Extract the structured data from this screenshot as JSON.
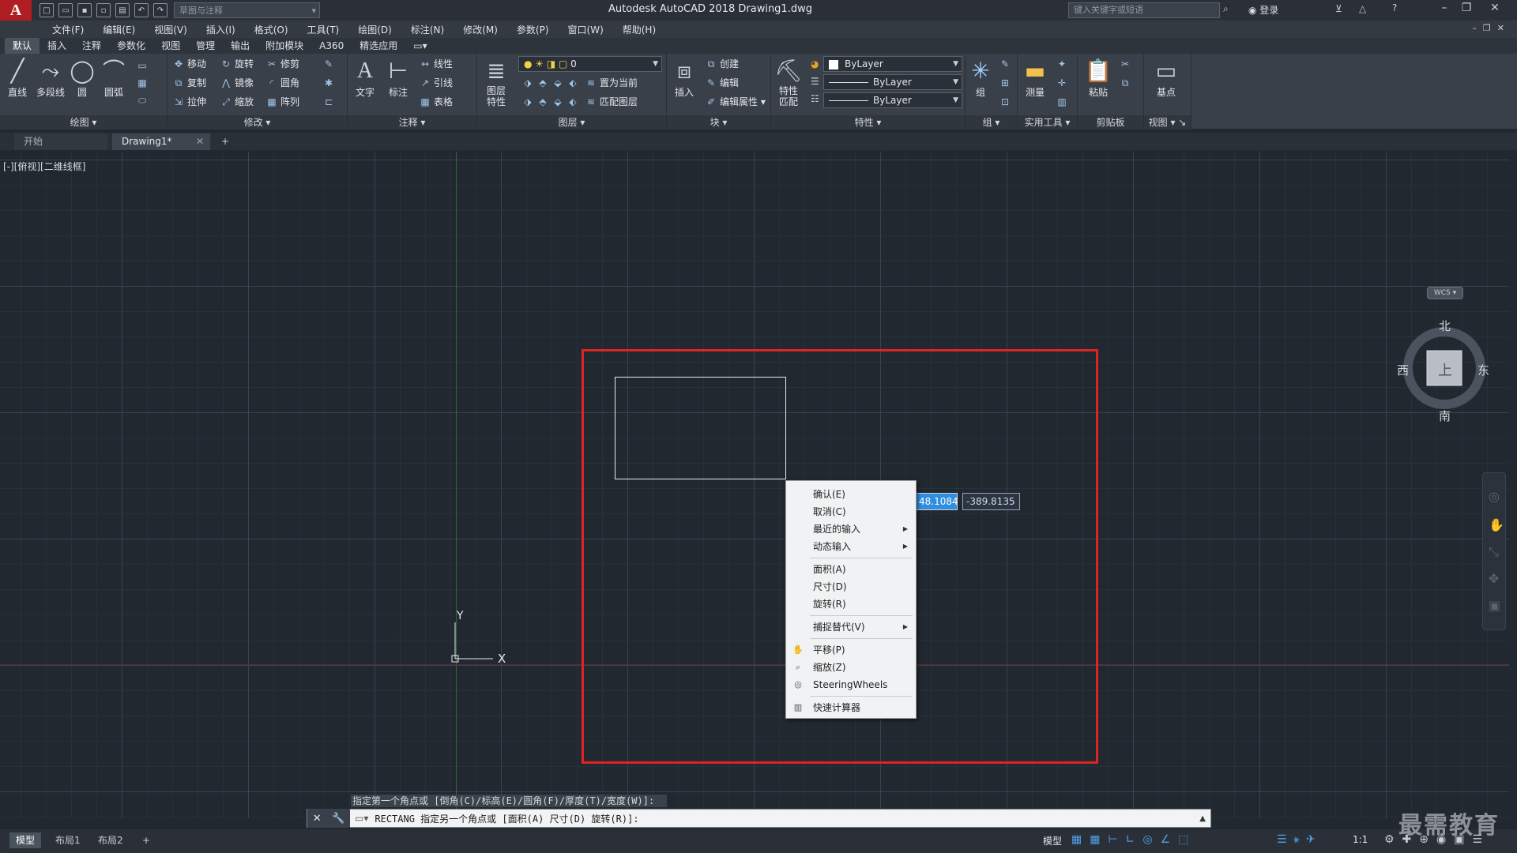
{
  "titlebar": {
    "logo": "A",
    "workspace": "草图与注释",
    "app_title": "Autodesk AutoCAD 2018    Drawing1.dwg",
    "search_placeholder": "键入关键字或短语",
    "login": "登录"
  },
  "menubar": {
    "items": [
      "文件(F)",
      "编辑(E)",
      "视图(V)",
      "插入(I)",
      "格式(O)",
      "工具(T)",
      "绘图(D)",
      "标注(N)",
      "修改(M)",
      "参数(P)",
      "窗口(W)",
      "帮助(H)"
    ]
  },
  "ribbon_tabs": {
    "items": [
      "默认",
      "插入",
      "注释",
      "参数化",
      "视图",
      "管理",
      "输出",
      "附加模块",
      "A360",
      "精选应用"
    ],
    "active_index": 0
  },
  "ribbon": {
    "draw": {
      "title": "绘图",
      "line": "直线",
      "polyline": "多段线",
      "circle": "圆",
      "arc": "圆弧"
    },
    "modify": {
      "title": "修改",
      "move": "移动",
      "rotate": "旋转",
      "trim": "修剪",
      "copy": "复制",
      "mirror": "镜像",
      "fillet": "圆角",
      "stretch": "拉伸",
      "scale": "缩放",
      "array": "阵列"
    },
    "annotation": {
      "title": "注释",
      "text": "文字",
      "dimension": "标注",
      "linear": "线性",
      "leader": "引线",
      "table": "表格"
    },
    "layers": {
      "title": "图层",
      "layer_props": "图层\n特性",
      "layer_value": "0",
      "set_current": "置为当前",
      "match_layer": "匹配图层"
    },
    "block": {
      "title": "块",
      "insert": "插入",
      "create": "创建",
      "edit": "编辑",
      "edit_attr": "编辑属性"
    },
    "properties": {
      "title": "特性",
      "match": "特性\n匹配",
      "color": "ByLayer",
      "linetype": "ByLayer",
      "lineweight": "ByLayer"
    },
    "groups": {
      "title": "组",
      "group": "组"
    },
    "utilities": {
      "title": "实用工具",
      "measure": "测量"
    },
    "clipboard": {
      "title": "剪贴板",
      "paste": "粘贴"
    },
    "view": {
      "title": "视图",
      "base": "基点"
    }
  },
  "doc_tabs": {
    "start": "开始",
    "drawing": "Drawing1*"
  },
  "canvas": {
    "view_label": "[-][俯视][二维线框]"
  },
  "ucs": {
    "y": "Y",
    "x": "X"
  },
  "dyn_input": {
    "x_value": "48.1084",
    "y_value": "-389.8135"
  },
  "context_menu": {
    "confirm": "确认(E)",
    "cancel": "取消(C)",
    "recent_input": "最近的输入",
    "dynamic_input": "动态输入",
    "area": "面积(A)",
    "dimensions": "尺寸(D)",
    "rotation": "旋转(R)",
    "snap_override": "捕捉替代(V)",
    "pan": "平移(P)",
    "zoom": "缩放(Z)",
    "steering": "SteeringWheels",
    "quickcalc": "快速计算器"
  },
  "viewcube": {
    "north": "北",
    "south": "南",
    "east": "东",
    "west": "西",
    "top": "上",
    "wcs": "WCS"
  },
  "command": {
    "history": "指定第一个角点或 [倒角(C)/标高(E)/圆角(F)/厚度(T)/宽度(W)]:",
    "prompt": "RECTANG 指定另一个角点或 [面积(A) 尺寸(D) 旋转(R)]:"
  },
  "statusbar": {
    "model_tab": "模型",
    "layout1": "布局1",
    "layout2": "布局2",
    "model": "模型",
    "scale": "1:1"
  },
  "watermark": "最需教育"
}
